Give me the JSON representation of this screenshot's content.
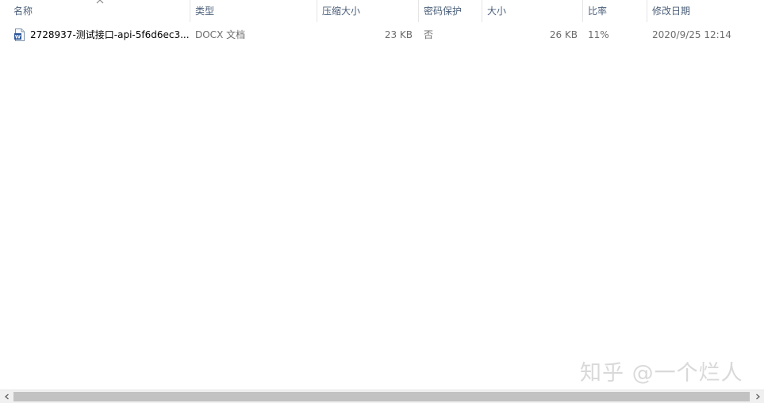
{
  "columns": {
    "name": "名称",
    "type": "类型",
    "compressed_size": "压缩大小",
    "password_protected": "密码保护",
    "size": "大小",
    "ratio": "比率",
    "modified_date": "修改日期"
  },
  "sort": {
    "column": "name",
    "direction": "ascending",
    "icon": "chevron-up-icon"
  },
  "files": [
    {
      "name": "2728937-测试接口-api-5f6d6ec3...",
      "type": "DOCX 文档",
      "compressed_size": "23 KB",
      "password_protected": "否",
      "size": "26 KB",
      "ratio": "11%",
      "modified_date": "2020/9/25 12:14",
      "icon": "word-document-icon"
    }
  ],
  "watermark": "知乎 @一个烂人",
  "colors": {
    "header_text": "#4c607a",
    "meta_text": "#6d6d6d",
    "word_icon_blue": "#2b579a",
    "scroll_thumb": "#c2c2c2",
    "scroll_track": "#f0f0f0"
  }
}
